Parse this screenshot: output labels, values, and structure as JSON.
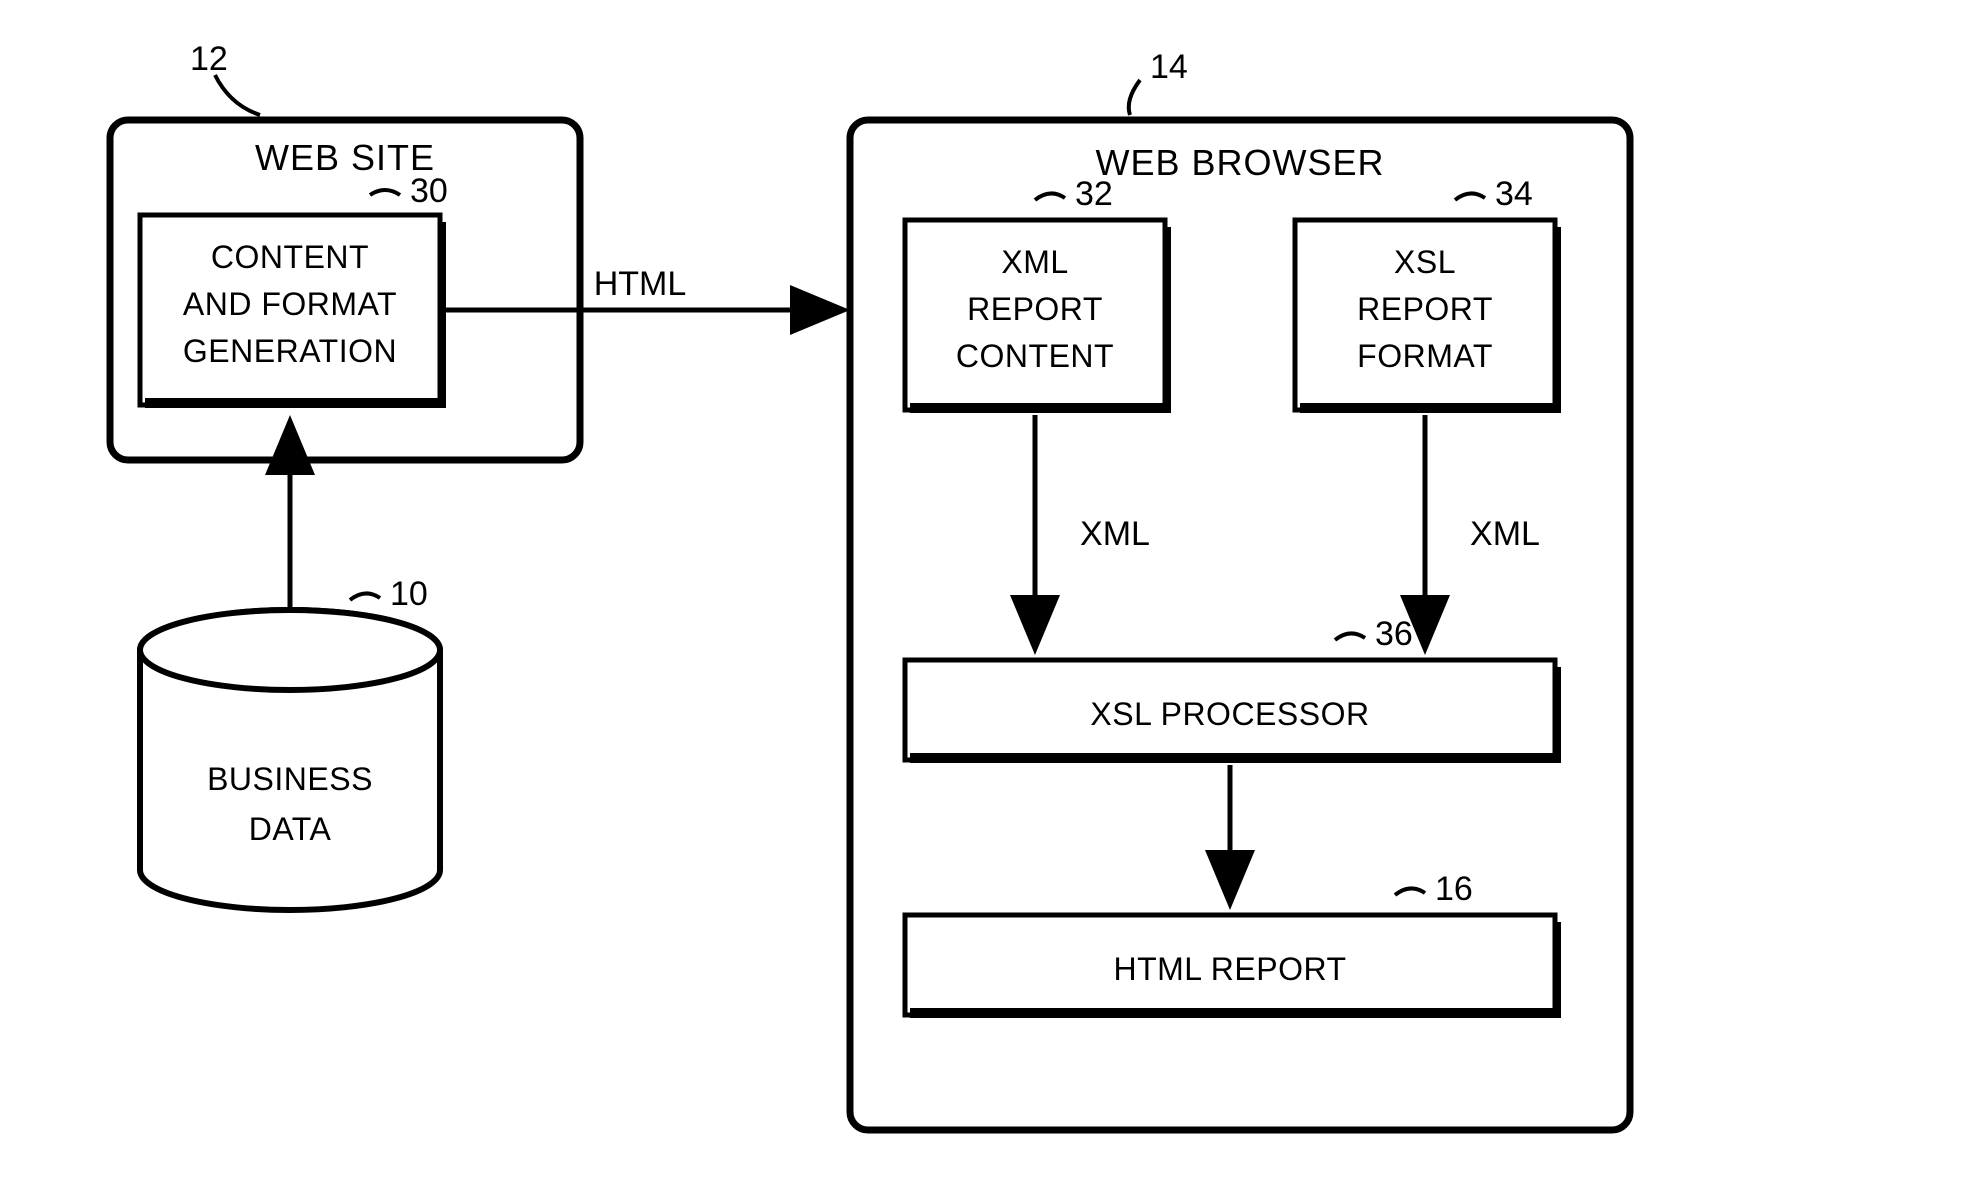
{
  "refs": {
    "business_data": "10",
    "web_site": "12",
    "web_browser": "14",
    "html_report": "16",
    "content_gen": "30",
    "xml_content": "32",
    "xsl_format": "34",
    "xsl_processor": "36"
  },
  "boxes": {
    "web_site_title": "WEB SITE",
    "web_browser_title": "WEB BROWSER",
    "content_gen_line1": "CONTENT",
    "content_gen_line2": "AND FORMAT",
    "content_gen_line3": "GENERATION",
    "xml_content_line1": "XML",
    "xml_content_line2": "REPORT",
    "xml_content_line3": "CONTENT",
    "xsl_format_line1": "XSL",
    "xsl_format_line2": "REPORT",
    "xsl_format_line3": "FORMAT",
    "xsl_processor": "XSL PROCESSOR",
    "html_report": "HTML REPORT",
    "business_data_line1": "BUSINESS",
    "business_data_line2": "DATA"
  },
  "arrows": {
    "html": "HTML",
    "xml_left": "XML",
    "xml_right": "XML"
  }
}
